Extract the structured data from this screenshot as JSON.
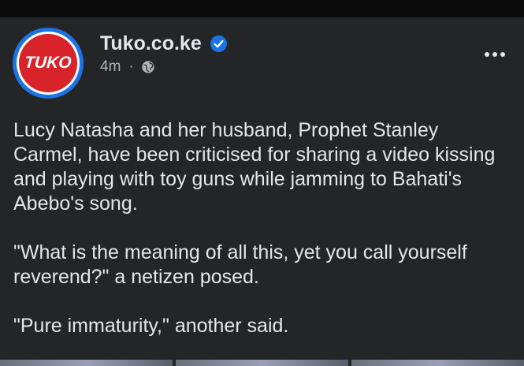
{
  "page": {
    "name": "Tuko.co.ke",
    "logo_text": "TUKO",
    "time": "4m",
    "separator": "·"
  },
  "icons": {
    "verified": "verified-badge-icon",
    "audience": "globe-icon",
    "more": "more-options-icon"
  },
  "post": {
    "paragraphs": [
      "Lucy Natasha and her husband, Prophet Stanley Carmel, have been criticised for sharing a video kissing and playing with toy guns while jamming to Bahati's Abebo's song.",
      "\"What is the meaning of all this, yet you call yourself reverend?\" a netizen posed.",
      "\"Pure immaturity,\" another said."
    ]
  },
  "colors": {
    "background": "#242526",
    "text_primary": "#e4e6eb",
    "text_secondary": "#b0b3b8",
    "accent_blue": "#1b74e4",
    "brand_red": "#d8232a"
  }
}
